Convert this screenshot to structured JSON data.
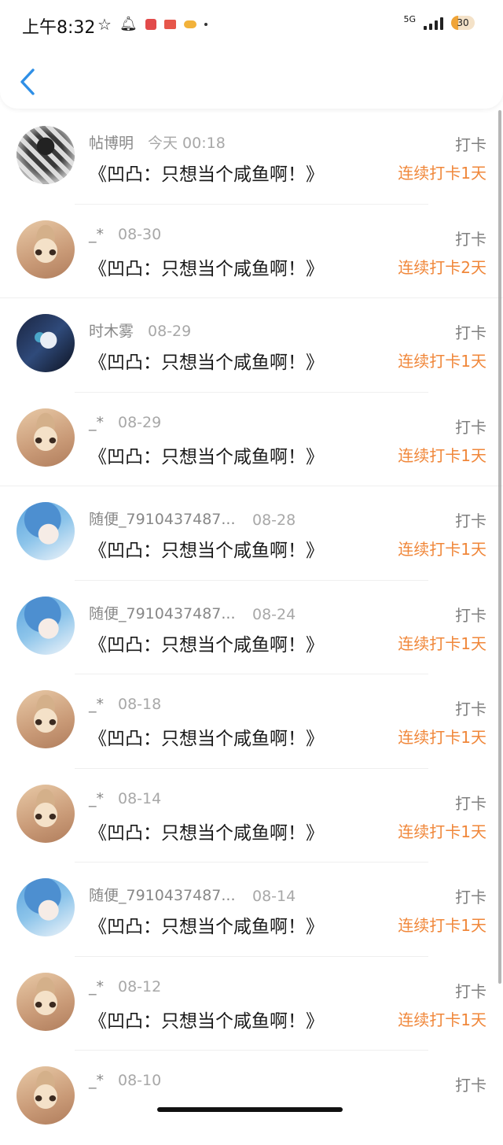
{
  "status_bar": {
    "time": "上午8:32",
    "network": "5G",
    "battery": "30"
  },
  "header": {
    "back_icon": "chevron-left-icon"
  },
  "rows": [
    {
      "name": "帖博明",
      "date": "今天 00:18",
      "title": "《凹凸：只想当个咸鱼啊！》",
      "action": "打卡",
      "streak": "连续打卡1天",
      "avatar": "bw"
    },
    {
      "name": "_*",
      "date": "08-30",
      "title": "《凹凸：只想当个咸鱼啊！》",
      "action": "打卡",
      "streak": "连续打卡2天",
      "avatar": "dog"
    },
    {
      "name": "时木雾",
      "date": "08-29",
      "title": "《凹凸：只想当个咸鱼啊！》",
      "action": "打卡",
      "streak": "连续打卡1天",
      "avatar": "dark"
    },
    {
      "name": "_*",
      "date": "08-29",
      "title": "《凹凸：只想当个咸鱼啊！》",
      "action": "打卡",
      "streak": "连续打卡1天",
      "avatar": "dog"
    },
    {
      "name": "随便_7910437487...",
      "date": "08-28",
      "title": "《凹凸：只想当个咸鱼啊！》",
      "action": "打卡",
      "streak": "连续打卡1天",
      "avatar": "blue"
    },
    {
      "name": "随便_7910437487...",
      "date": "08-24",
      "title": "《凹凸：只想当个咸鱼啊！》",
      "action": "打卡",
      "streak": "连续打卡1天",
      "avatar": "blue"
    },
    {
      "name": "_*",
      "date": "08-18",
      "title": "《凹凸：只想当个咸鱼啊！》",
      "action": "打卡",
      "streak": "连续打卡1天",
      "avatar": "dog"
    },
    {
      "name": "_*",
      "date": "08-14",
      "title": "《凹凸：只想当个咸鱼啊！》",
      "action": "打卡",
      "streak": "连续打卡1天",
      "avatar": "dog"
    },
    {
      "name": "随便_7910437487...",
      "date": "08-14",
      "title": "《凹凸：只想当个咸鱼啊！》",
      "action": "打卡",
      "streak": "连续打卡1天",
      "avatar": "blue"
    },
    {
      "name": "_*",
      "date": "08-12",
      "title": "《凹凸：只想当个咸鱼啊！》",
      "action": "打卡",
      "streak": "连续打卡1天",
      "avatar": "dog"
    },
    {
      "name": "_*",
      "date": "08-10",
      "title": "",
      "action": "打卡",
      "streak": "",
      "avatar": "dog"
    }
  ],
  "colors": {
    "accent_back": "#2f8fe6",
    "streak": "#f0873a",
    "name": "#888888",
    "title": "#1a1a1a"
  }
}
